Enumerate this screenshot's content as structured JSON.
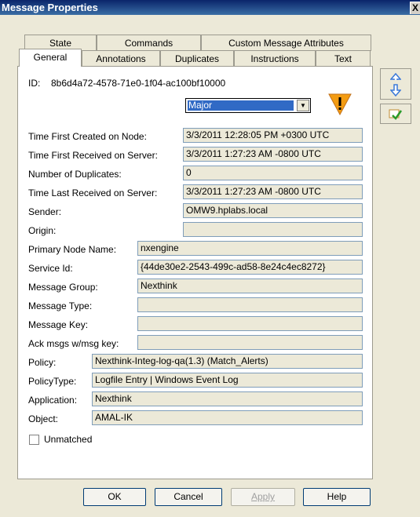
{
  "window": {
    "title": "Message Properties",
    "close_label": "X"
  },
  "tabs": {
    "row1": [
      "State",
      "Commands",
      "Custom Message Attributes"
    ],
    "row2": [
      "General",
      "Annotations",
      "Duplicates",
      "Instructions",
      "Text"
    ],
    "active": "General"
  },
  "general": {
    "id_label": "ID:",
    "id_value": "8b6d4a72-4578-71e0-1f04-ac100bf10000",
    "severity": "Major",
    "fields": [
      {
        "label": "Time First Created on Node:",
        "value": "3/3/2011  12:28:05 PM  +0300 UTC"
      },
      {
        "label": "Time First Received on Server:",
        "value": "3/3/2011  1:27:23 AM  -0800 UTC"
      },
      {
        "label": "Number of Duplicates:",
        "value": "0"
      },
      {
        "label": "Time Last Received on Server:",
        "value": "3/3/2011  1:27:23 AM  -0800 UTC"
      },
      {
        "label": "Sender:",
        "value": "OMW9.hplabs.local"
      },
      {
        "label": "Origin:",
        "value": ""
      },
      {
        "label": "Primary Node Name:",
        "value": "nxengine"
      },
      {
        "label": "Service Id:",
        "value": "{44de30e2-2543-499c-ad58-8e24c4ec8272}"
      },
      {
        "label": "Message Group:",
        "value": "Nexthink"
      },
      {
        "label": "Message Type:",
        "value": ""
      },
      {
        "label": "Message Key:",
        "value": ""
      },
      {
        "label": "Ack msgs w/msg key:",
        "value": ""
      },
      {
        "label": "Policy:",
        "value": "Nexthink-Integ-log-qa(1.3)  (Match_Alerts)"
      },
      {
        "label": "PolicyType:",
        "value": "Logfile Entry | Windows Event Log"
      },
      {
        "label": "Application:",
        "value": "Nexthink"
      },
      {
        "label": "Object:",
        "value": "AMAL-IK"
      }
    ],
    "unmatched_label": "Unmatched",
    "unmatched_checked": false
  },
  "buttons": {
    "ok": "OK",
    "cancel": "Cancel",
    "apply": "Apply",
    "help": "Help"
  },
  "colors": {
    "severity_major": "#f39c12",
    "title_bar": "#0a246a",
    "arrow_blue": "#3a78d8"
  }
}
